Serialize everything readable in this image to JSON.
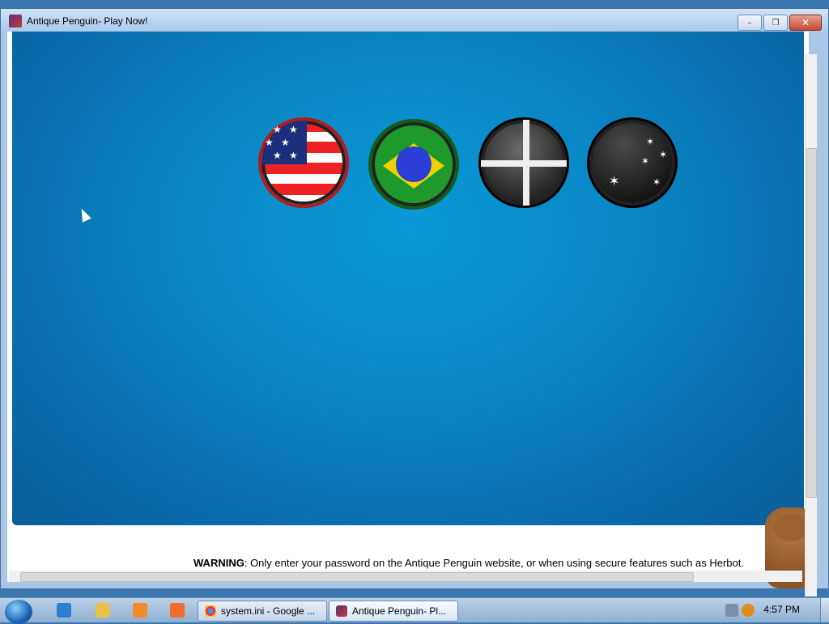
{
  "window": {
    "title": "Antique Penguin- Play Now!",
    "controls": {
      "minimize": "–",
      "restore": "❐",
      "close": "✕"
    }
  },
  "game": {
    "flags": [
      {
        "name": "usa",
        "label": ""
      },
      {
        "name": "brazil",
        "label": ""
      },
      {
        "name": "uk",
        "label": ""
      },
      {
        "name": "australia",
        "label": ""
      }
    ]
  },
  "warning": {
    "prefix": "WARNING",
    "text": ": Only enter your password on the Antique Penguin website, or when using secure features such as Herbot."
  },
  "taskbar": {
    "tasks": [
      {
        "label": "system.ini - Google ..."
      },
      {
        "label": "Antique Penguin- Pl..."
      }
    ],
    "clock": "4:57 PM"
  },
  "colors": {
    "stage_blue": "#0a86c4",
    "titlebar": "#a8c8ea"
  }
}
